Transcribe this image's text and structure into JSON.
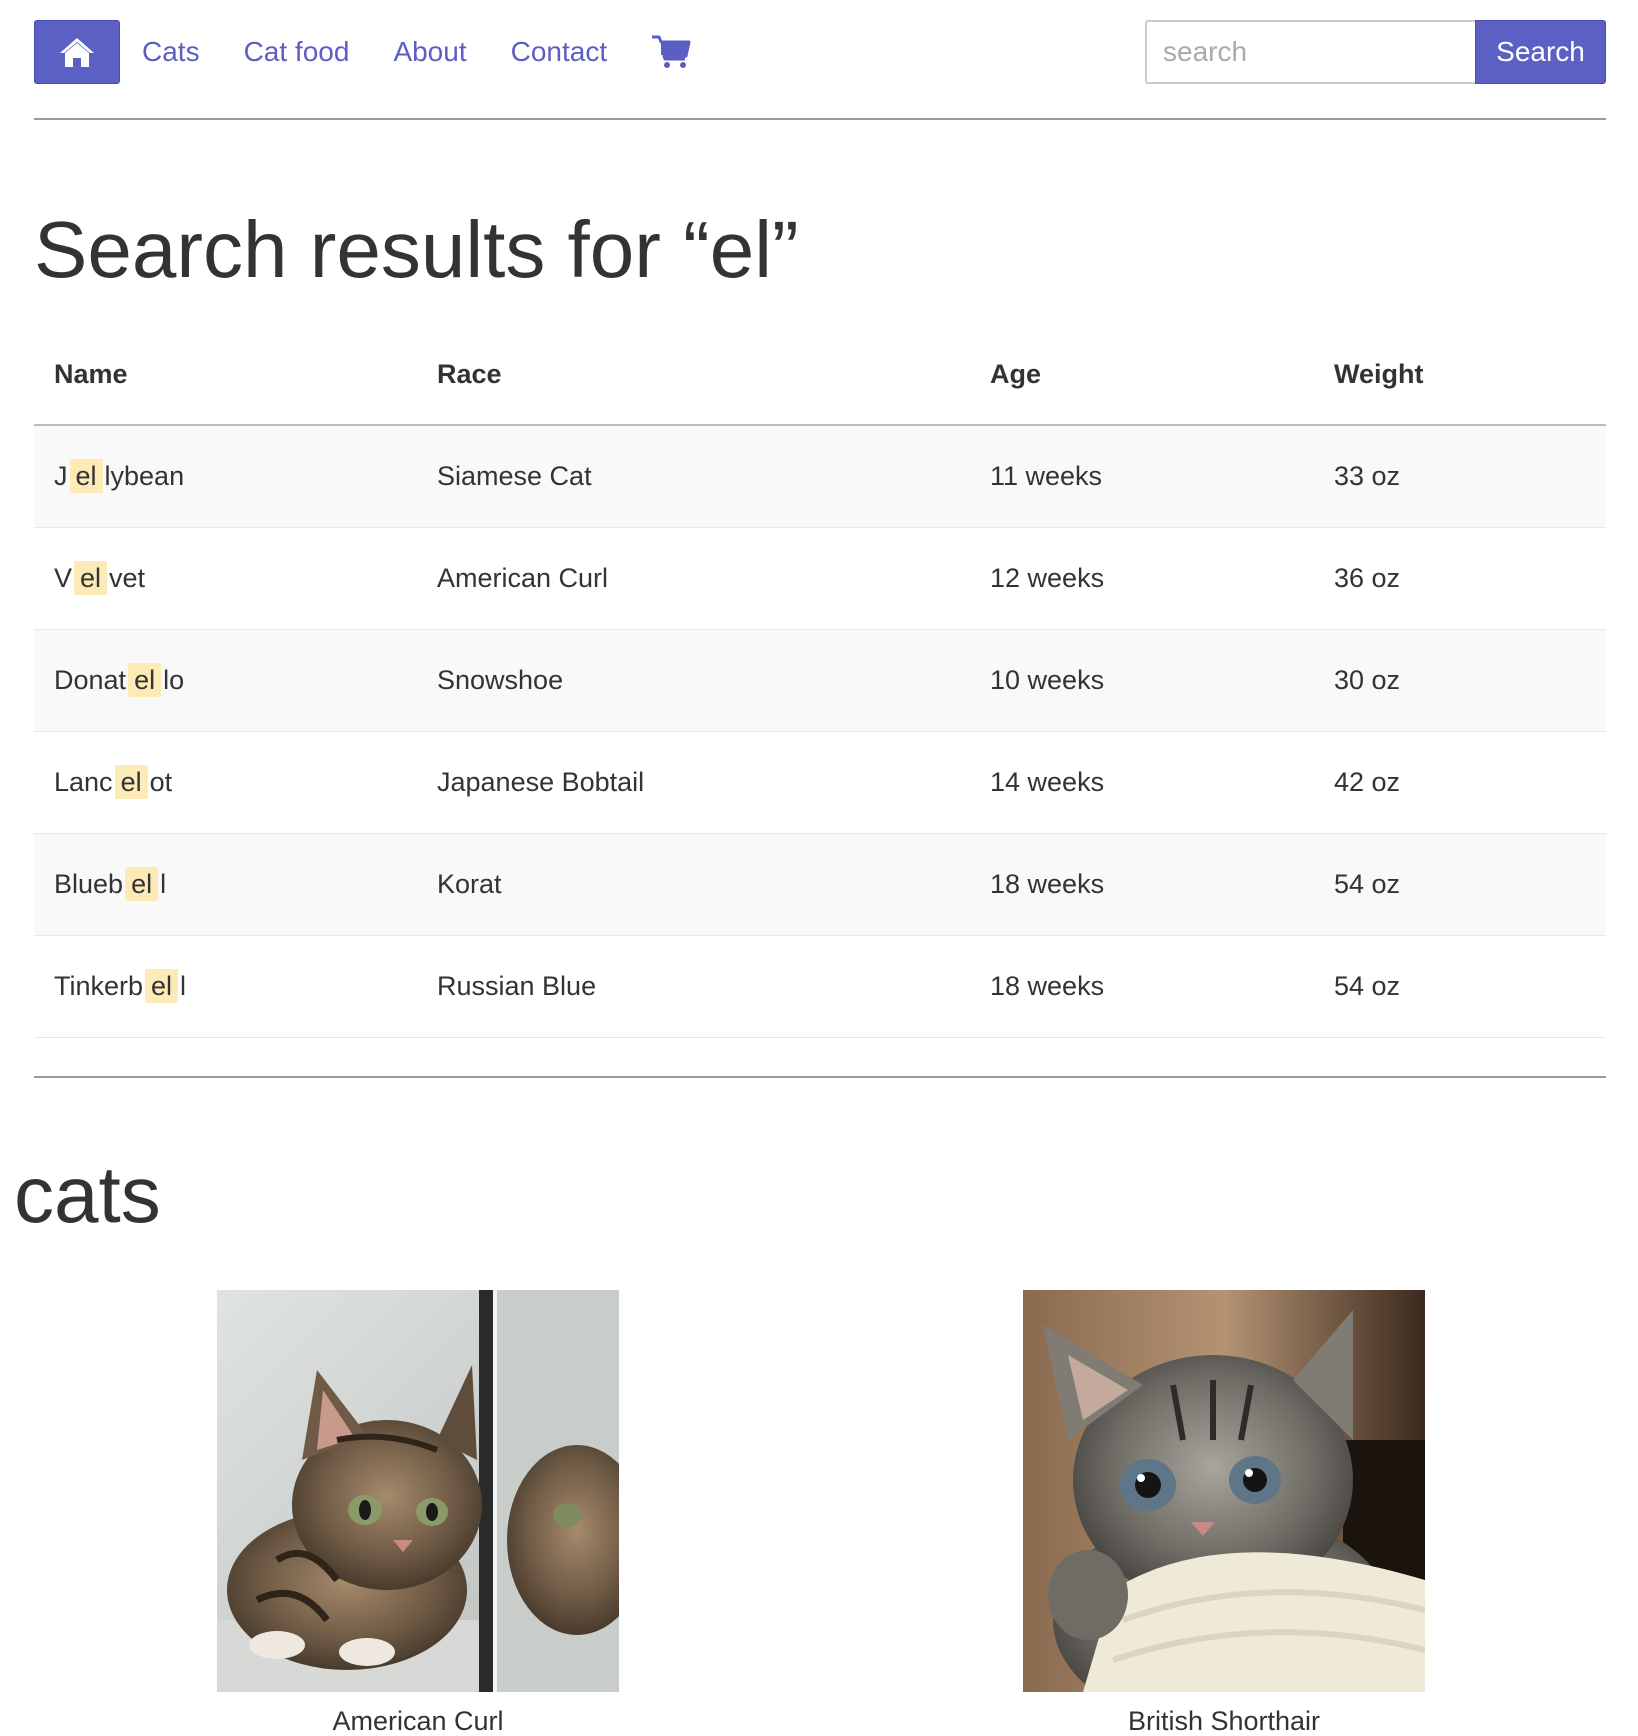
{
  "nav": {
    "home_icon": "home-icon",
    "links": [
      "Cats",
      "Cat food",
      "About",
      "Contact"
    ],
    "cart_icon": "shopping-cart-icon",
    "search_placeholder": "search",
    "search_button": "Search",
    "accent_color": "#5c5fc4"
  },
  "results": {
    "title": "Search results for “el”",
    "query": "el",
    "columns": [
      "Name",
      "Race",
      "Age",
      "Weight"
    ],
    "rows": [
      {
        "name_pre": "J",
        "name_match": "el",
        "name_post": "lybean",
        "race": "Siamese Cat",
        "age": "11 weeks",
        "weight": "33 oz"
      },
      {
        "name_pre": "V",
        "name_match": "el",
        "name_post": "vet",
        "race": "American Curl",
        "age": "12 weeks",
        "weight": "36 oz"
      },
      {
        "name_pre": "Donat",
        "name_match": "el",
        "name_post": "lo",
        "race": "Snowshoe",
        "age": "10 weeks",
        "weight": "30 oz"
      },
      {
        "name_pre": "Lanc",
        "name_match": "el",
        "name_post": "ot",
        "race": "Japanese Bobtail",
        "age": "14 weeks",
        "weight": "42 oz"
      },
      {
        "name_pre": "Blueb",
        "name_match": "el",
        "name_post": "l",
        "race": "Korat",
        "age": "18 weeks",
        "weight": "54 oz"
      },
      {
        "name_pre": "Tinkerb",
        "name_match": "el",
        "name_post": "l",
        "race": "Russian Blue",
        "age": "18 weeks",
        "weight": "54 oz"
      }
    ],
    "highlight_color": "#fcebb6"
  },
  "cats": {
    "title": "cats",
    "items": [
      {
        "caption": "American Curl"
      },
      {
        "caption": "British Shorthair"
      }
    ]
  }
}
